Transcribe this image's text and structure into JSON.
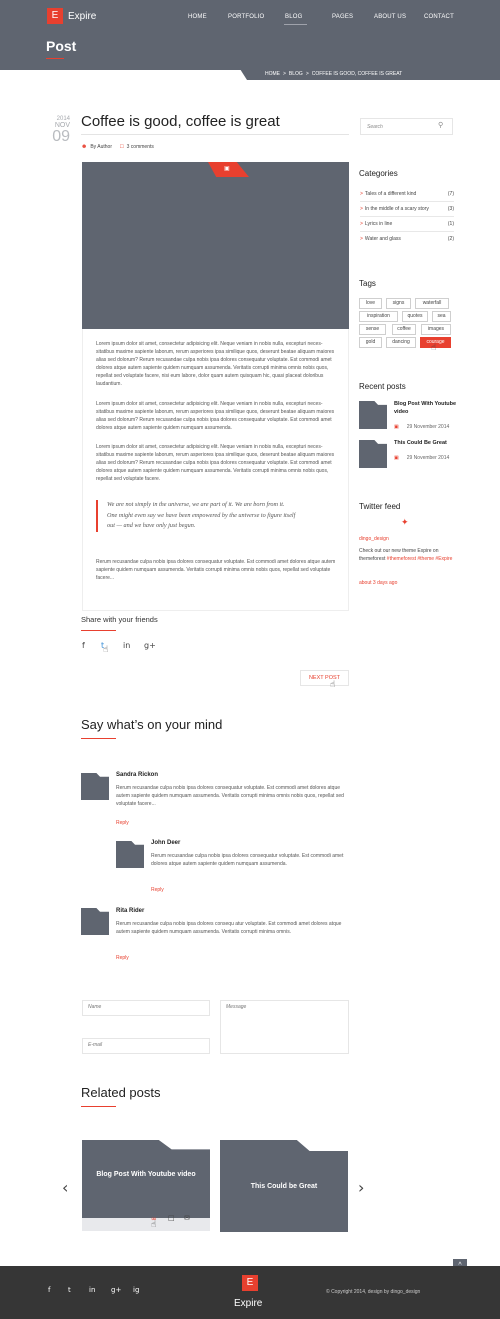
{
  "brand": {
    "logo_letter": "E",
    "name": "Expire"
  },
  "nav": [
    "HOME",
    "PORTFOLIO",
    "BLOG",
    "PAGES",
    "ABOUT US",
    "CONTACT"
  ],
  "page_title": "Post",
  "breadcrumb": [
    "HOME",
    ">",
    "BLOG",
    ">",
    "COFFEE IS GOOD, COFFEE IS GREAT"
  ],
  "post": {
    "year": "2014",
    "month": "NOV",
    "day": "09",
    "title": "Coffee is good, coffee is great",
    "author": "By Author",
    "comments": "3 comments",
    "paragraphs": [
      "Lorem ipsum dolor sit amet, consectetur adipisicing elit. Neque veniam in nobis nulla, excepturi neces-sitatibus maxime sapiente laborum, rerum asperiores ipsa similique quos, deserunt beatae aliquam maiores alias sed dolorum? Rerum recusandae culpa nobis ipsa dolores consequatur voluptate. Est commodi amet dolores atque autem sapiente quidem numquam assumenda. Veritatis corrupti minima omnis nobis quos, repellat sed voluptate facere, nisi eum labore, dolor quam autem quisquam hic, quasi placeat doloribus laudantium.",
      "Lorem ipsum dolor sit amet, consectetur adipisicing elit. Neque veniam in nobis nulla, excepturi neces-sitatibus maxime sapiente laborum, rerum asperiores ipsa similique quos, deserunt beatae aliquam maiores alias sed dolorum? Rerum recusandae culpa nobis ipsa dolores consequatur voluptate. Est commodi amet dolores atque autem sapiente quidem numquam assumenda.",
      "Lorem ipsum dolor sit amet, consectetur adipisicing elit. Neque veniam in nobis nulla, excepturi neces-sitatibus maxime sapiente laborum, rerum asperiores ipsa similique quos, deserunt beatae aliquam maiores alias sed dolorum? Rerum recusandae culpa nobis ipsa dolores consequatur voluptate. Est commodi amet dolores atque autem sapiente quidem numquam assumenda. Veritatis corrupti minima omnis nobis quos, repellat sed voluptate facere."
    ],
    "quote": "We are not simply in the universe, we are part of it. We are born from it. One might even say we have been empowered by the universe to figure itself out — and we have only just begun.",
    "closing": "Rerum recusandae culpa nobis ipsa dolores consequatur voluptate. Est commodi amet dolores atque autem sapiente quidem numquam assumenda. Veritatis corrupti minima omnis nobis quos, repellat sed voluptate facere..."
  },
  "share": {
    "title": "Share with your friends",
    "icons": [
      "f",
      "t",
      "in",
      "g+"
    ]
  },
  "next_post": "NEXT POST",
  "comments_section": {
    "title": "Say what’s on your mind",
    "comments": [
      {
        "name": "Sandra Rickon",
        "text": "Rerum recusandae culpa nobis ipsa dolores consequatur voluptate. Est commodi amet dolores atque autem sapiente quidem numquam assumenda. Veritatis corrupti minima omnis nobis quos, repellat sed voluptate facere...",
        "reply": "Reply"
      },
      {
        "name": "John Deer",
        "text": "Rerum recusandae culpa nobis ipsa dolores consequatur voluptate. Est commodi amet dolores atque autem sapiente quidem numquam assumenda.",
        "reply": "Reply"
      },
      {
        "name": "Rita Rider",
        "text": "Rerum recusandae culpa nobis ipsa dolores consequ atur voluptate. Est commodi amet dolores atque autem sapiente quidem numquam assumenda. Veritatis corrupti minima omnis.",
        "reply": "Reply"
      }
    ]
  },
  "form": {
    "name_placeholder": "Name",
    "email_placeholder": "E-mail",
    "message_placeholder": "Message"
  },
  "related": {
    "title": "Related posts",
    "items": [
      "Blog Post With Youtube video",
      "This Could be Great"
    ]
  },
  "sidebar": {
    "search_placeholder": "Search",
    "categories_title": "Categories",
    "categories": [
      {
        "label": "Tales of a different kind",
        "count": "(7)"
      },
      {
        "label": "In the middle of a scary story",
        "count": "(3)"
      },
      {
        "label": "Lyrics in line",
        "count": "(1)"
      },
      {
        "label": "Water and glass",
        "count": "(2)"
      }
    ],
    "tags_title": "Tags",
    "tags": [
      "love",
      "signs",
      "waterfall",
      "inspiration",
      "quotes",
      "sea",
      "sense",
      "coffee",
      "images",
      "gold",
      "dancing",
      "courage"
    ],
    "recent_title": "Recent posts",
    "recent": [
      {
        "title": "Blog Post With Youtube video",
        "date": "29 November 2014"
      },
      {
        "title": "This Could Be Great",
        "date": "29 November 2014"
      }
    ],
    "twitter_title": "Twitter feed",
    "tweet_user": "dingo_design",
    "tweet_text": "Check out our new theme Expire on themeforest",
    "tweet_tags": "#themeforest #theme #Expire",
    "tweet_time": "about 3 days ago"
  },
  "footer": {
    "social": [
      "f",
      "t",
      "in",
      "g+",
      "ig"
    ],
    "logo_letter": "E",
    "brand": "Expire",
    "copyright": "© Copyright 2014, design by dingo_design"
  },
  "colors": {
    "accent": "#e8402f",
    "header": "#5f6570",
    "footer": "#363636"
  }
}
